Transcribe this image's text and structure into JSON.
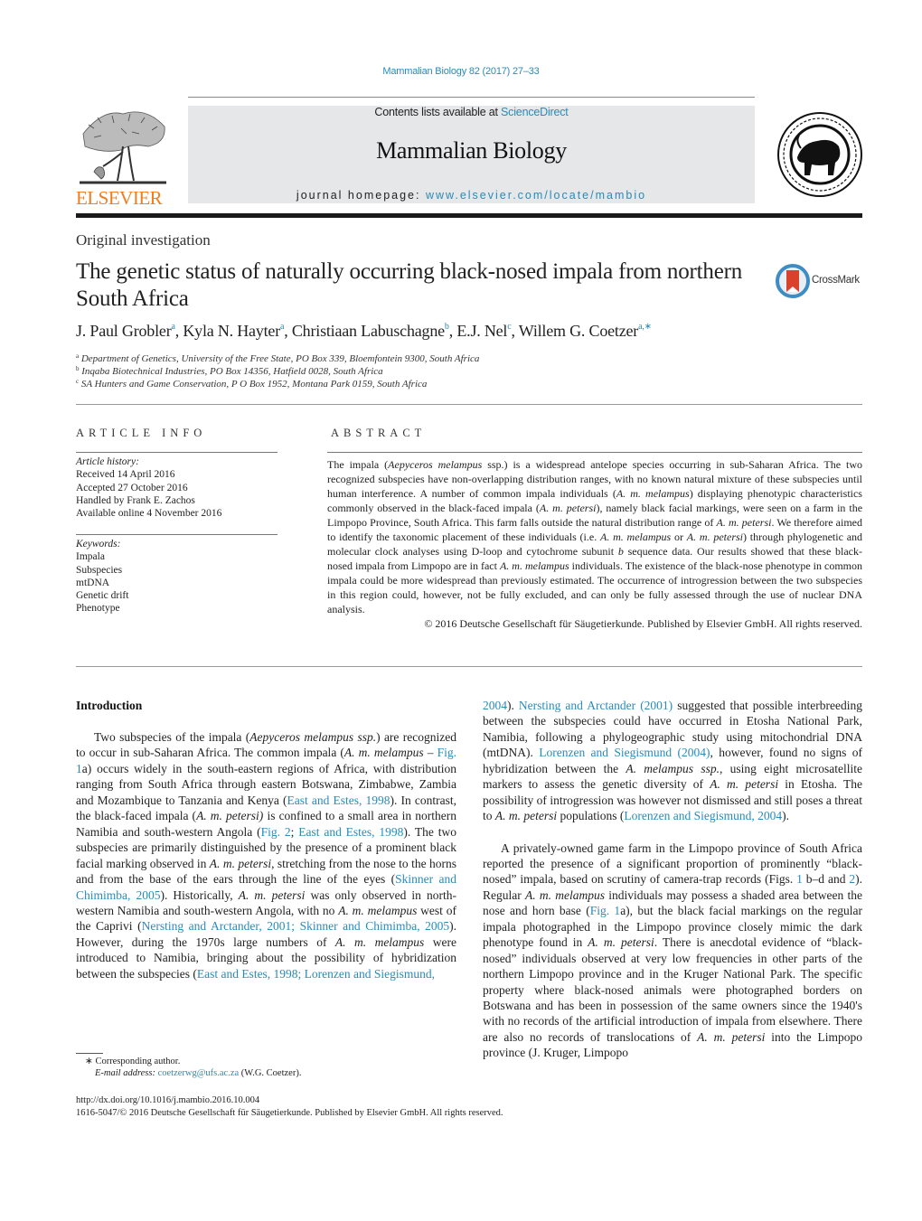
{
  "header": {
    "citation": "Mammalian Biology 82 (2017) 27–33",
    "contents_prefix": "Contents lists available at ",
    "contents_link": "ScienceDirect",
    "journal_name": "Mammalian Biology",
    "homepage_prefix": "journal homepage: ",
    "homepage_link": "www.elsevier.com/locate/mambio",
    "publisher_logo_text": "ELSEVIER",
    "society_logo": "Deutsche Gesellschaft für Säugetierkunde seal"
  },
  "article": {
    "section_type": "Original investigation",
    "title": "The genetic status of naturally occurring black-nosed impala from northern South Africa",
    "crossmark_label": "CrossMark",
    "authors": [
      {
        "name": "J. Paul Grobler",
        "sup": "a",
        "sep": ", "
      },
      {
        "name": "Kyla N. Hayter",
        "sup": "a",
        "sep": ", "
      },
      {
        "name": "Christiaan Labuschagne",
        "sup": "b",
        "sep": ", "
      },
      {
        "name": "E.J. Nel",
        "sup": "c",
        "sep": ", "
      },
      {
        "name": "Willem G. Coetzer",
        "sup": "a,∗",
        "sep": ""
      }
    ],
    "affiliations": [
      {
        "sup": "a",
        "text": "Department of Genetics, University of the Free State, PO Box 339, Bloemfontein 9300, South Africa"
      },
      {
        "sup": "b",
        "text": "Inqaba Biotechnical Industries, PO Box 14356, Hatfield 0028, South Africa"
      },
      {
        "sup": "c",
        "text": "SA Hunters and Game Conservation, P O Box 1952, Montana Park 0159, South Africa"
      }
    ]
  },
  "article_info": {
    "heading": "ARTICLE INFO",
    "history_label": "Article history:",
    "history": [
      "Received 14 April 2016",
      "Accepted 27 October 2016",
      "Handled by Frank E. Zachos",
      "Available online 4 November 2016"
    ],
    "keywords_label": "Keywords:",
    "keywords": [
      "Impala",
      "Subspecies",
      "mtDNA",
      "Genetic drift",
      "Phenotype"
    ]
  },
  "abstract": {
    "heading": "ABSTRACT",
    "segments": [
      {
        "t": "The impala ("
      },
      {
        "t": "Aepyceros melampus",
        "i": true
      },
      {
        "t": " ssp.) is a widespread antelope species occurring in sub-Saharan Africa. The two recognized subspecies have non-overlapping distribution ranges, with no known natural mixture of these subspecies until human interference. A number of common impala individuals ("
      },
      {
        "t": "A. m. melampus",
        "i": true
      },
      {
        "t": ") displaying phenotypic characteristics commonly observed in the black-faced impala ("
      },
      {
        "t": "A. m. petersi",
        "i": true
      },
      {
        "t": "), namely black facial markings, were seen on a farm in the Limpopo Province, South Africa. This farm falls outside the natural distribution range of "
      },
      {
        "t": "A. m. petersi",
        "i": true
      },
      {
        "t": ". We therefore aimed to identify the taxonomic placement of these individuals (i.e. "
      },
      {
        "t": "A. m. melampus",
        "i": true
      },
      {
        "t": " or "
      },
      {
        "t": "A. m. petersi",
        "i": true
      },
      {
        "t": ") through phylogenetic and molecular clock analyses using D-loop and cytochrome subunit "
      },
      {
        "t": "b",
        "i": true
      },
      {
        "t": " sequence data. Our results showed that these black-nosed impala from Limpopo are in fact "
      },
      {
        "t": "A. m. melampus",
        "i": true
      },
      {
        "t": " individuals. The existence of the black-nose phenotype in common impala could be more widespread than previously estimated. The occurrence of introgression between the two subspecies in this region could, however, not be fully excluded, and can only be fully assessed through the use of nuclear DNA analysis."
      }
    ],
    "copyright": "© 2016 Deutsche Gesellschaft für Säugetierkunde. Published by Elsevier GmbH. All rights reserved."
  },
  "body": {
    "intro_heading": "Introduction",
    "left_column": [
      {
        "t": "Two subspecies of the impala ("
      },
      {
        "t": "Aepyceros melampus ssp.",
        "i": true
      },
      {
        "t": ") are recognized to occur in sub-Saharan Africa. The common impala ("
      },
      {
        "t": "A. m. melampus",
        "i": true
      },
      {
        "t": " – "
      },
      {
        "t": "Fig. 1",
        "l": true
      },
      {
        "t": "a) occurs widely in the south-eastern regions of Africa, with distribution ranging from South Africa through eastern Botswana, Zimbabwe, Zambia and Mozambique to Tanzania and Kenya ("
      },
      {
        "t": "East and Estes, 1998",
        "l": true
      },
      {
        "t": "). In contrast, the black-faced impala ("
      },
      {
        "t": "A. m. petersi)",
        "i": true
      },
      {
        "t": " is confined to a small area in northern Namibia and south-western Angola ("
      },
      {
        "t": "Fig. 2",
        "l": true
      },
      {
        "t": "; "
      },
      {
        "t": "East and Estes, 1998",
        "l": true
      },
      {
        "t": "). The two subspecies are primarily distinguished by the presence of a prominent black facial marking observed in "
      },
      {
        "t": "A. m. petersi",
        "i": true
      },
      {
        "t": ", stretching from the nose to the horns and from the base of the ears through the line of the eyes ("
      },
      {
        "t": "Skinner and Chimimba, 2005",
        "l": true
      },
      {
        "t": "). Historically, "
      },
      {
        "t": "A. m. petersi",
        "i": true
      },
      {
        "t": " was only observed in north-western Namibia and south-western Angola, with no "
      },
      {
        "t": "A. m. melampus",
        "i": true
      },
      {
        "t": " west of the Caprivi ("
      },
      {
        "t": "Nersting and Arctander, 2001; Skinner and Chimimba, 2005",
        "l": true
      },
      {
        "t": "). However, during the 1970s large numbers of "
      },
      {
        "t": "A. m. melampus",
        "i": true
      },
      {
        "t": " were introduced to Namibia, bringing about the possibility of hybridization between the subspecies ("
      },
      {
        "t": "East and Estes, 1998; Lorenzen and Siegismund,",
        "l": true
      }
    ],
    "right_column_p1": [
      {
        "t": "2004",
        "l": true
      },
      {
        "t": "). "
      },
      {
        "t": "Nersting and Arctander (2001)",
        "l": true
      },
      {
        "t": " suggested that possible interbreeding between the subspecies could have occurred in Etosha National Park, Namibia, following a phylogeographic study using mitochondrial DNA (mtDNA). "
      },
      {
        "t": "Lorenzen and Siegismund (2004)",
        "l": true
      },
      {
        "t": ", however, found no signs of hybridization between the "
      },
      {
        "t": "A. melampus ssp.",
        "i": true
      },
      {
        "t": ", using eight microsatellite markers to assess the genetic diversity of "
      },
      {
        "t": "A. m. petersi",
        "i": true
      },
      {
        "t": " in Etosha. The possibility of introgression was however not dismissed and still poses a threat to "
      },
      {
        "t": "A. m. petersi",
        "i": true
      },
      {
        "t": " populations ("
      },
      {
        "t": "Lorenzen and Siegismund, 2004",
        "l": true
      },
      {
        "t": ")."
      }
    ],
    "right_column_p2": [
      {
        "t": "A privately-owned game farm in the Limpopo province of South Africa reported the presence of a significant proportion of prominently “black-nosed” impala, based on scrutiny of camera-trap records (Figs. "
      },
      {
        "t": "1",
        "l": true
      },
      {
        "t": " b–d and "
      },
      {
        "t": "2",
        "l": true
      },
      {
        "t": "). Regular "
      },
      {
        "t": "A. m. melampus",
        "i": true
      },
      {
        "t": " individuals may possess a shaded area between the nose and horn base ("
      },
      {
        "t": "Fig. 1",
        "l": true
      },
      {
        "t": "a), but the black facial markings on the regular impala photographed in the Limpopo province closely mimic the dark phenotype found in "
      },
      {
        "t": "A. m. petersi",
        "i": true
      },
      {
        "t": ". There is anecdotal evidence of “black-nosed” individuals observed at very low frequencies in other parts of the northern Limpopo province and in the Kruger National Park. The specific property where black-nosed animals were photographed borders on Botswana and has been in possession of the same owners since the 1940's with no records of the artificial introduction of impala from elsewhere. There are also no records of translocations of "
      },
      {
        "t": "A. m. petersi",
        "i": true
      },
      {
        "t": " into the Limpopo province (J. Kruger, Limpopo"
      }
    ]
  },
  "footnotes": {
    "corresponding_marker": "∗",
    "corresponding": "Corresponding author.",
    "email_label": "E-mail address: ",
    "email": "coetzerwg@ufs.ac.za",
    "email_suffix": " (W.G. Coetzer).",
    "doi": "http://dx.doi.org/10.1016/j.mambio.2016.10.004",
    "issn_line": "1616-5047/© 2016 Deutsche Gesellschaft für Säugetierkunde. Published by Elsevier GmbH. All rights reserved."
  },
  "colors": {
    "link": "#2a8ab8",
    "elsevier_orange": "#f07d1e",
    "banner_gray": "#e6e7e8",
    "crossmark_red": "#d9412b",
    "crossmark_blue": "#3d8cc4"
  }
}
